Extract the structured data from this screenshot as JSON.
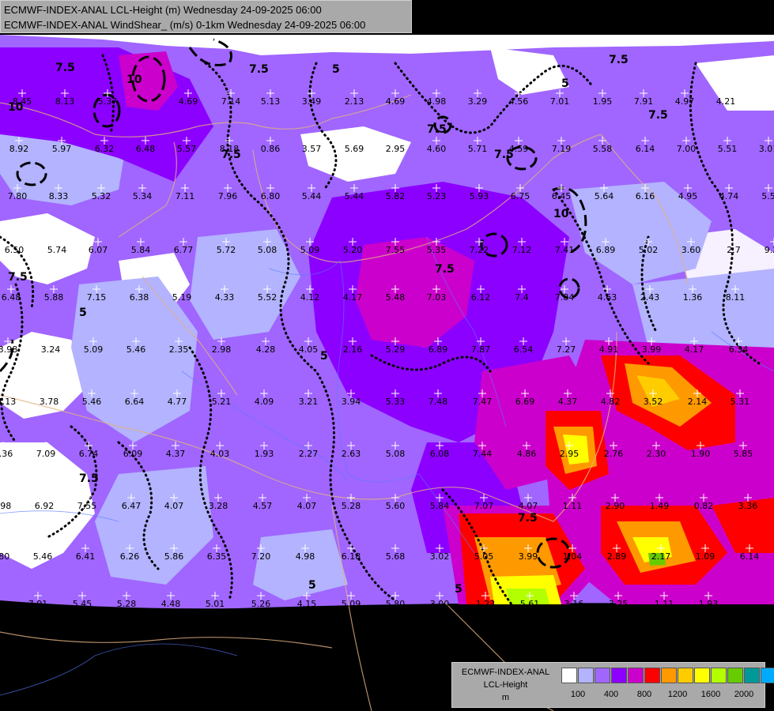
{
  "title": {
    "line1": "ECMWF-INDEX-ANAL LCL-Height (m) Wednesday 24-09-2025 06:00",
    "line2": "ECMWF-INDEX-ANAL WindShear_ (m/s) 0-1km Wednesday 24-09-2025 06:00"
  },
  "legend": {
    "line1": "ECMWF-INDEX-ANAL",
    "line2": "LCL-Height",
    "line3": "m",
    "colors": [
      "#ffffff",
      "#b3b3ff",
      "#a066ff",
      "#8c00ff",
      "#cc00cc",
      "#ff0000",
      "#ff9900",
      "#ffcc00",
      "#ffff00",
      "#b3ff00",
      "#66cc00",
      "#009999",
      "#00aaff"
    ],
    "ticks": [
      "100",
      "400",
      "800",
      "1200",
      "1600",
      "2000"
    ]
  },
  "contour_labels": [
    "7.5",
    "10",
    "5"
  ],
  "shear_values": [
    "8.45",
    "8.13",
    "5.37",
    "4.69",
    "7.14",
    "5.13",
    "3.49",
    "2.13",
    "4.69",
    "4.98",
    "3.29",
    "4.56",
    "7.01",
    "1.95",
    "7.91",
    "4.97",
    "4.21",
    "8.92",
    "5.97",
    "6.32",
    "6.48",
    "5.57",
    "8.18",
    "0.86",
    "3.57",
    "5.69",
    "2.95",
    "4.60",
    "5.71",
    "4.59",
    "7.19",
    "5.58",
    "6.14",
    "7.00",
    "5.51",
    "3.01",
    "7.80",
    "8.33",
    "5.32",
    "5.34",
    "7.11",
    "7.96",
    "6.80",
    "5.44",
    "5.44",
    "5.82",
    "5.23",
    "5.93",
    "6.75",
    "6.45",
    "5.64",
    "6.16",
    "4.95",
    "4.74",
    "5.5",
    "6.50",
    "5.74",
    "6.07",
    "5.84",
    "6.77",
    "5.72",
    "5.08",
    "5.09",
    "5.20",
    "7.55",
    "5.35",
    "7.22",
    "7.12",
    "7.41",
    "6.89",
    "5.02",
    "3.60",
    "2.7",
    "9.28",
    "6.48",
    "5.88",
    "7.15",
    "6.38",
    "5.19",
    "4.33",
    "5.52",
    "4.12",
    "4.17",
    "5.48",
    "7.03",
    "6.12",
    "7.4",
    "7.84",
    "4.63",
    "2.43",
    "1.36",
    "8.11",
    "3.98",
    "3.24",
    "5.09",
    "5.46",
    "2.35",
    "2.98",
    "4.28",
    "4.05",
    "2.16",
    "5.29",
    "6.89",
    "7.87",
    "6.54",
    "7.27",
    "4.91",
    "3.99",
    "4.17",
    "6.34",
    "4.13",
    "3.78",
    "5.46",
    "6.64",
    "4.77",
    "5.21",
    "4.09",
    "3.21",
    "3.94",
    "5.33",
    "7.48",
    "7.47",
    "6.69",
    "4.37",
    "4.82",
    "3.52",
    "2.14",
    "5.31",
    "5.36",
    "7.09",
    "6.74",
    "6.09",
    "4.37",
    "4.03",
    "1.93",
    "2.27",
    "2.63",
    "5.08",
    "6.08",
    "7.44",
    "4.86",
    "2.95",
    "2.76",
    "2.30",
    "1.90",
    "5.85",
    "5.98",
    "6.92",
    "7.55",
    "6.47",
    "4.07",
    "3.28",
    "4.57",
    "4.07",
    "5.28",
    "5.60",
    "5.84",
    "7.07",
    "4.07",
    "1.11",
    "2.90",
    "1.49",
    "0.82",
    "3.36",
    "4.80",
    "5.46",
    "6.41",
    "6.26",
    "5.86",
    "6.35",
    "7.20",
    "4.98",
    "6.18",
    "5.68",
    "3.02",
    "5.05",
    "3.99",
    "1.04",
    "2.89",
    "2.17",
    "1.09",
    "6.14",
    "7.01",
    "5.45",
    "5.28",
    "4.48",
    "5.01",
    "5.26",
    "4.15",
    "5.09",
    "5.80",
    "3.00",
    "1.23",
    "5.61",
    "3.16",
    "3.25",
    "1.11",
    "1.93"
  ]
}
